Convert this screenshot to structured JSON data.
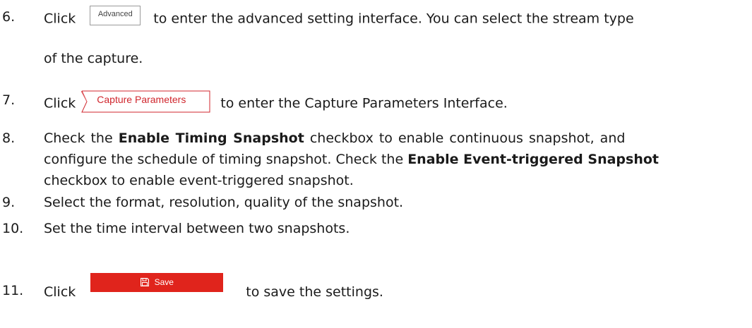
{
  "steps": [
    {
      "num": "6.",
      "parts": [
        "Click",
        "to enter the advanced setting interface. You can select the stream type"
      ],
      "continuation": "of the capture.",
      "button": "Advanced"
    },
    {
      "num": "7.",
      "parts": [
        "Click",
        "to enter the Capture Parameters Interface."
      ],
      "button": "Capture Parameters"
    },
    {
      "num": "8.",
      "line1": [
        "Check the",
        "Enable Timing Snapshot",
        "checkbox to enable continuous snapshot, and"
      ],
      "line2": [
        "configure the schedule of timing snapshot. Check the",
        "Enable Event-triggered Snapshot"
      ],
      "line3": "checkbox to enable event-triggered snapshot."
    },
    {
      "num": "9.",
      "text": "Select the format, resolution, quality of the snapshot."
    },
    {
      "num": "10.",
      "text": "Set the time interval between two snapshots."
    },
    {
      "num": "11.",
      "parts": [
        "Click",
        "to save the settings."
      ],
      "button": "Save"
    }
  ],
  "colors": {
    "save_bg": "#e0241c",
    "capture_text": "#d0262d"
  },
  "icons": {
    "save": "floppy-disk-icon"
  }
}
